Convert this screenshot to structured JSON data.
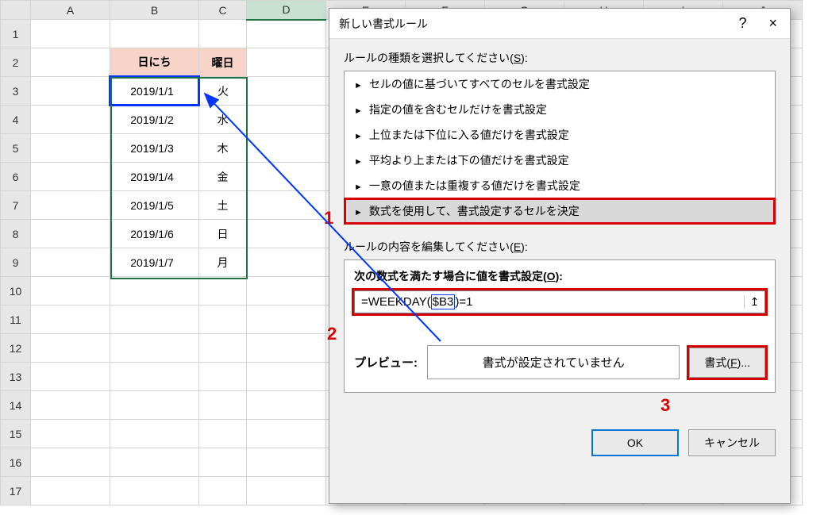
{
  "spreadsheet": {
    "columns": [
      "A",
      "B",
      "C",
      "D",
      "E",
      "F",
      "G",
      "H",
      "I",
      "J"
    ],
    "row_count": 17,
    "active_col": "D",
    "table_headers": {
      "b2": "日にち",
      "c2": "曜日"
    },
    "data_rows": [
      {
        "date": "2019/1/1",
        "day": "火"
      },
      {
        "date": "2019/1/2",
        "day": "水"
      },
      {
        "date": "2019/1/3",
        "day": "木"
      },
      {
        "date": "2019/1/4",
        "day": "金"
      },
      {
        "date": "2019/1/5",
        "day": "土"
      },
      {
        "date": "2019/1/6",
        "day": "日"
      },
      {
        "date": "2019/1/7",
        "day": "月"
      }
    ]
  },
  "dialog": {
    "title": "新しい書式ルール",
    "help_symbol": "?",
    "close_symbol": "×",
    "rule_type_label_pre": "ルールの種類を選択してください(",
    "rule_type_accel": "S",
    "rule_type_label_post": "):",
    "rule_types": [
      "セルの値に基づいてすべてのセルを書式設定",
      "指定の値を含むセルだけを書式設定",
      "上位または下位に入る値だけを書式設定",
      "平均より上または下の値だけを書式設定",
      "一意の値または重複する値だけを書式設定",
      "数式を使用して、書式設定するセルを決定"
    ],
    "rule_edit_label_pre": "ルールの内容を編集してください(",
    "rule_edit_accel": "E",
    "rule_edit_label_post": "):",
    "formula_label_pre": "次の数式を満たす場合に値を書式設定(",
    "formula_accel": "O",
    "formula_label_post": "):",
    "formula_prefix": "=WEEKDAY(",
    "formula_ref": "$B3",
    "formula_suffix": ")=1",
    "range_picker_icon": "↥",
    "preview_label": "プレビュー:",
    "preview_text": "書式が設定されていません",
    "format_button_pre": "書式(",
    "format_button_accel": "F",
    "format_button_post": ")...",
    "ok_button": "OK",
    "cancel_button": "キャンセル"
  },
  "annotations": {
    "n1": "1",
    "n2": "2",
    "n3": "3"
  },
  "chart_data": null
}
